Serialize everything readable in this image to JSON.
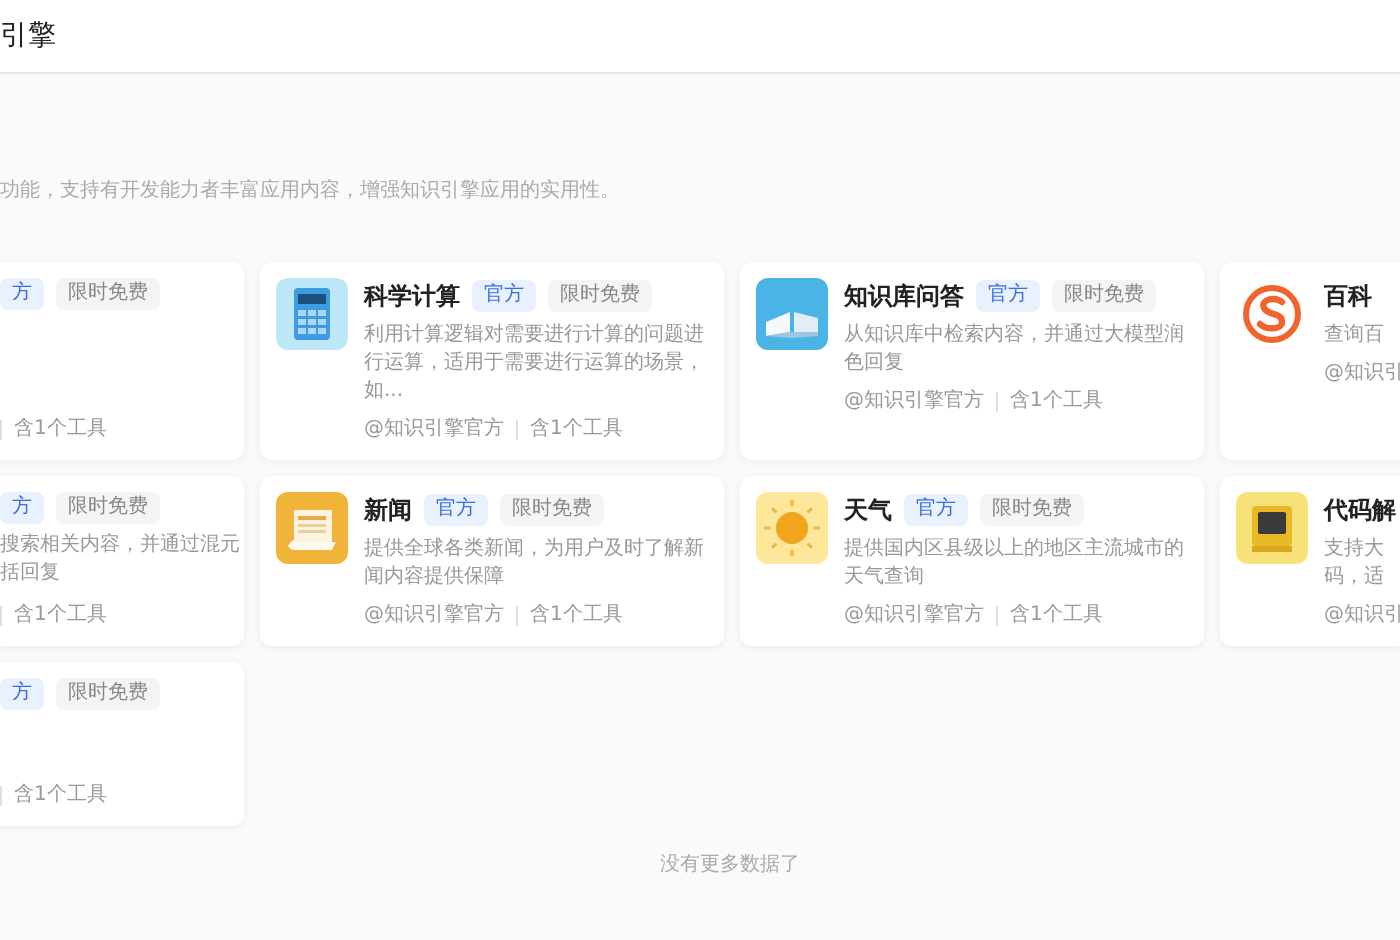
{
  "header": {
    "title": "引擎"
  },
  "intro": "功能，支持有开发能力者丰富应用内容，增强知识引擎应用的实用性。",
  "rows": [
    {
      "cards": [
        {
          "kind": "partial_left",
          "tags": [
            {
              "label": "方",
              "kind": "official"
            },
            {
              "label": "限时免费",
              "kind": "promo"
            }
          ],
          "tools": "含1个工具"
        },
        {
          "kind": "full",
          "title": "科学计算",
          "tags": [
            {
              "label": "官方",
              "kind": "official"
            },
            {
              "label": "限时免费",
              "kind": "promo"
            }
          ],
          "description_lines": [
            "利用计算逻辑对需要进行计算的问题进行运算，适用于需要进行运算的场景，如..."
          ],
          "author": "@知识引擎官方",
          "tools": "含1个工具"
        },
        {
          "kind": "full",
          "title": "知识库问答",
          "tags": [
            {
              "label": "官方",
              "kind": "official"
            },
            {
              "label": "限时免费",
              "kind": "promo"
            }
          ],
          "description_lines": [
            "从知识库中检索内容，并通过大模型润色回复"
          ],
          "author": "@知识引擎官方",
          "tools": "含1个工具"
        },
        {
          "kind": "partial_right",
          "title": "百科",
          "description_lines": [
            "查询百"
          ],
          "author": "@知识引"
        }
      ]
    },
    {
      "cards": [
        {
          "kind": "partial_left",
          "tags": [
            {
              "label": "方",
              "kind": "official"
            },
            {
              "label": "限时免费",
              "kind": "promo"
            }
          ],
          "description_lines": [
            "搜索相关内容，并通过混元",
            "括回复"
          ],
          "tools": "含1个工具"
        },
        {
          "kind": "full",
          "title": "新闻",
          "tags": [
            {
              "label": "官方",
              "kind": "official"
            },
            {
              "label": "限时免费",
              "kind": "promo"
            }
          ],
          "description_lines": [
            "提供全球各类新闻，为用户及时了解新闻内容提供保障"
          ],
          "author": "@知识引擎官方",
          "tools": "含1个工具"
        },
        {
          "kind": "full",
          "title": "天气",
          "tags": [
            {
              "label": "官方",
              "kind": "official"
            },
            {
              "label": "限时免费",
              "kind": "promo"
            }
          ],
          "description_lines": [
            "提供国内区县级以上的地区主流城市的天气查询"
          ],
          "author": "@知识引擎官方",
          "tools": "含1个工具"
        },
        {
          "kind": "partial_right",
          "title": "代码解",
          "description_lines": [
            "支持大",
            "码，适"
          ],
          "author": "@知识引"
        }
      ]
    },
    {
      "cards": [
        {
          "kind": "partial_left",
          "tags": [
            {
              "label": "方",
              "kind": "official"
            },
            {
              "label": "限时免费",
              "kind": "promo"
            }
          ],
          "tools": "含1个工具"
        }
      ]
    }
  ],
  "footer": "没有更多数据了"
}
